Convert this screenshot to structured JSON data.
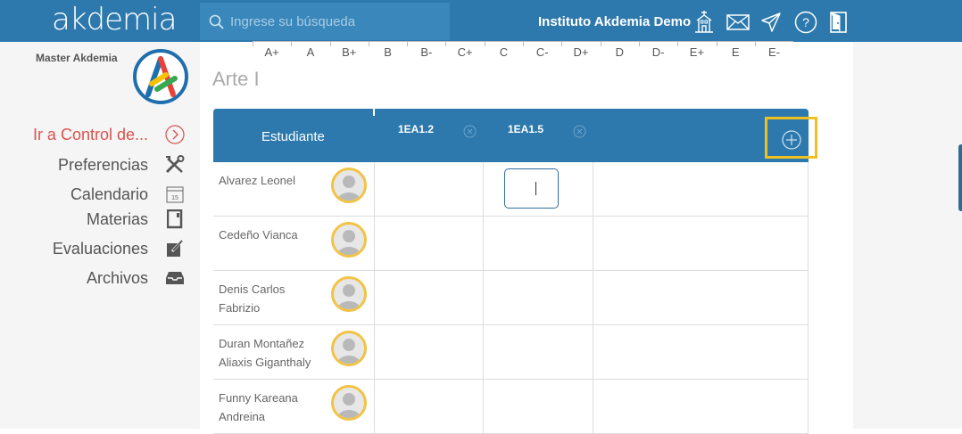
{
  "header": {
    "logo": "akdemia",
    "search_placeholder": "Ingrese su búsqueda",
    "institution": "Instituto Akdemia Demo",
    "icons": [
      "school-icon",
      "mail-icon",
      "send-icon",
      "help-icon",
      "logout-icon"
    ]
  },
  "sidebar": {
    "user": "Master Akdemia",
    "items": [
      {
        "label": "Ir a Control de...",
        "icon": "chevron-right-circle-icon",
        "accent": "#d9534f"
      },
      {
        "label": "Preferencias",
        "icon": "tools-icon"
      },
      {
        "label": "Calendario",
        "icon": "calendar-icon"
      },
      {
        "label": "Materias",
        "icon": "book-icon"
      },
      {
        "label": "Evaluaciones",
        "icon": "edit-icon"
      },
      {
        "label": "Archivos",
        "icon": "inbox-icon"
      }
    ]
  },
  "grade_scale": [
    "A+",
    "A",
    "B+",
    "B",
    "B-",
    "C+",
    "C",
    "C-",
    "D+",
    "D",
    "D-",
    "E+",
    "E",
    "E-"
  ],
  "course_title": "Arte I",
  "table": {
    "student_header": "Estudiante",
    "columns": [
      "1EA1.2",
      "1EA1.5"
    ],
    "students": [
      {
        "line1": "Alvarez Leonel",
        "line2": ""
      },
      {
        "line1": "Cedeño Vianca",
        "line2": ""
      },
      {
        "line1": "Denis Carlos",
        "line2": "Fabrizio"
      },
      {
        "line1": "Duran Montañez",
        "line2": "Aliaxis Giganthaly"
      },
      {
        "line1": "Funny Kareana",
        "line2": "Andreina"
      }
    ]
  },
  "colors": {
    "primary": "#2d79ad",
    "highlight": "#f0c020",
    "accent": "#d9534f"
  }
}
